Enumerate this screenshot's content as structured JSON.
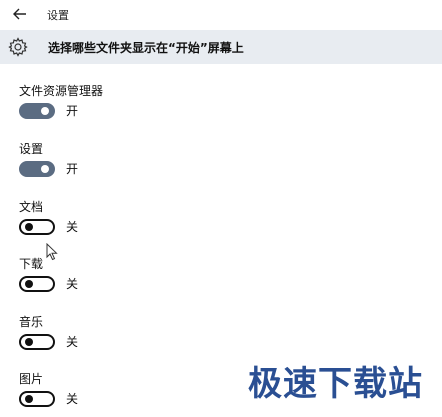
{
  "window": {
    "title": "设置"
  },
  "header": {
    "title": "选择哪些文件夹显示在“开始”屏幕上"
  },
  "settings": [
    {
      "label": "文件资源管理器",
      "state": "开",
      "on": true
    },
    {
      "label": "设置",
      "state": "开",
      "on": true
    },
    {
      "label": "文档",
      "state": "关",
      "on": false
    },
    {
      "label": "下载",
      "state": "关",
      "on": false
    },
    {
      "label": "音乐",
      "state": "关",
      "on": false
    },
    {
      "label": "图片",
      "state": "关",
      "on": false
    }
  ],
  "watermark": {
    "text": "极速下载站"
  },
  "colors": {
    "toggle_on": "#5b6c82",
    "header_bg": "#e8ecf1",
    "watermark": "#2a4f93"
  },
  "icons": {
    "back": "back-arrow-icon",
    "settings": "gear-icon",
    "cursor": "mouse-pointer-icon"
  }
}
